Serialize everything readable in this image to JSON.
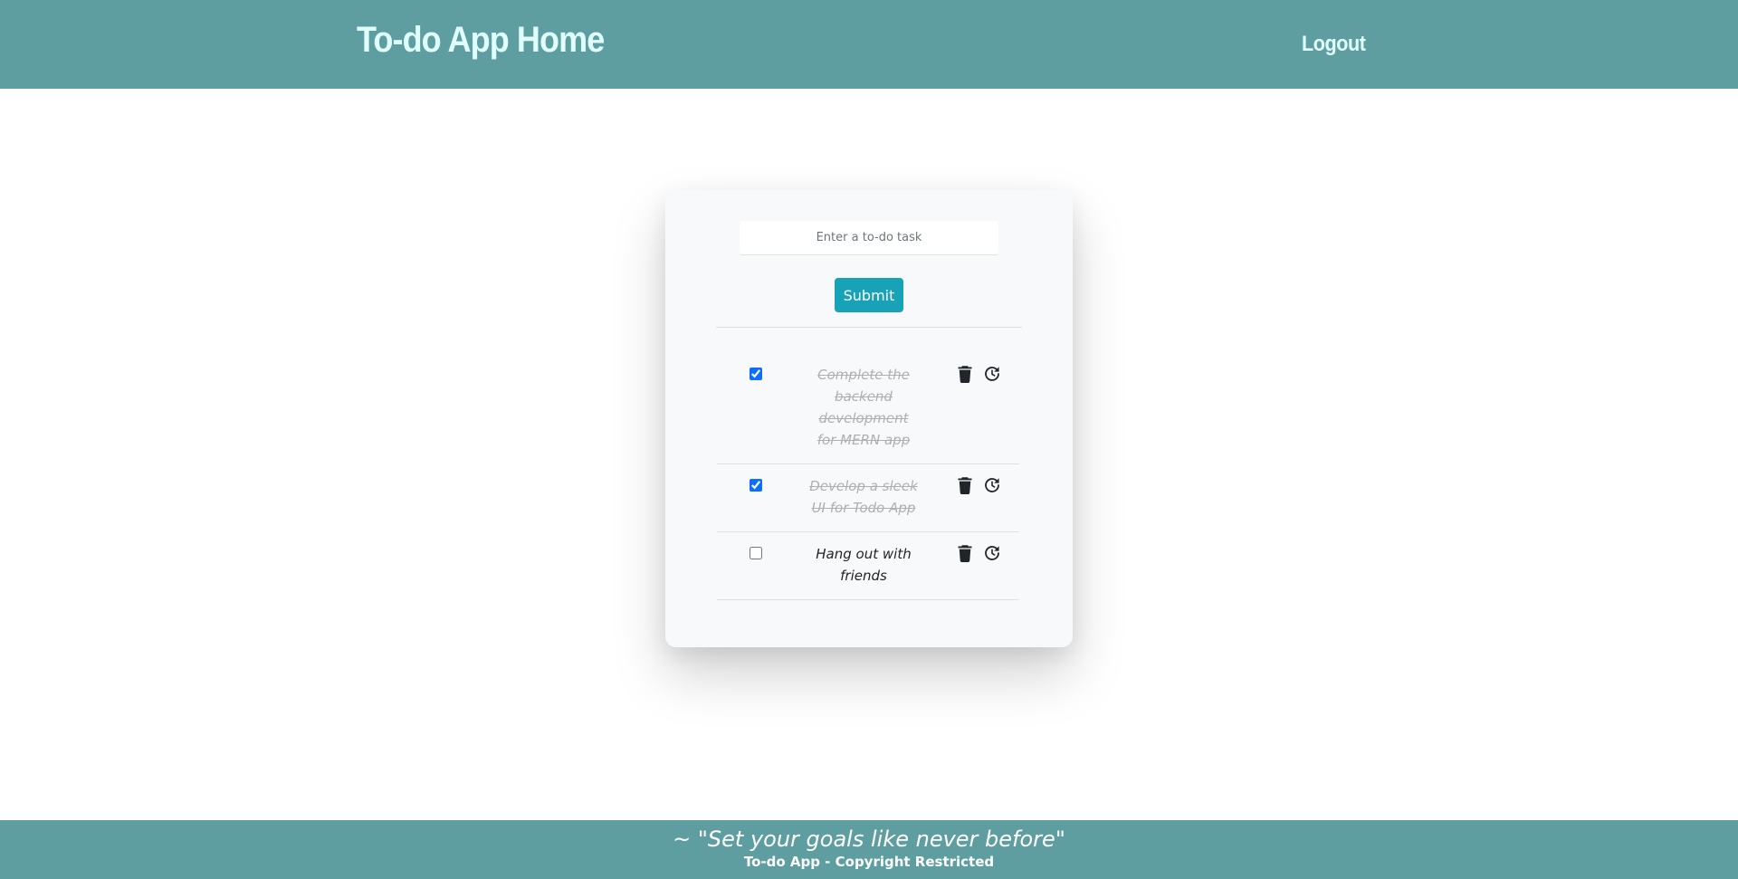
{
  "header": {
    "title": "To-do App Home",
    "logout_label": "Logout"
  },
  "form": {
    "placeholder": "Enter a to-do task",
    "submit_label": "Submit"
  },
  "todos": [
    {
      "text": "Complete the backend development for MERN app",
      "completed": true
    },
    {
      "text": "Develop a sleek UI for Todo App",
      "completed": true
    },
    {
      "text": "Hang out with friends",
      "completed": false
    }
  ],
  "icons": {
    "delete": "trash-icon",
    "restore": "clock-rotate-icon"
  },
  "footer": {
    "quote": "~ \"Set your goals like never before\"",
    "copyright": "To-do App - Copyright Restricted"
  },
  "colors": {
    "header_bg": "#5f9ea0",
    "title_color": "#e0ffff",
    "submit_bg": "#17a2b8",
    "completed_text": "#b0b0b0"
  }
}
